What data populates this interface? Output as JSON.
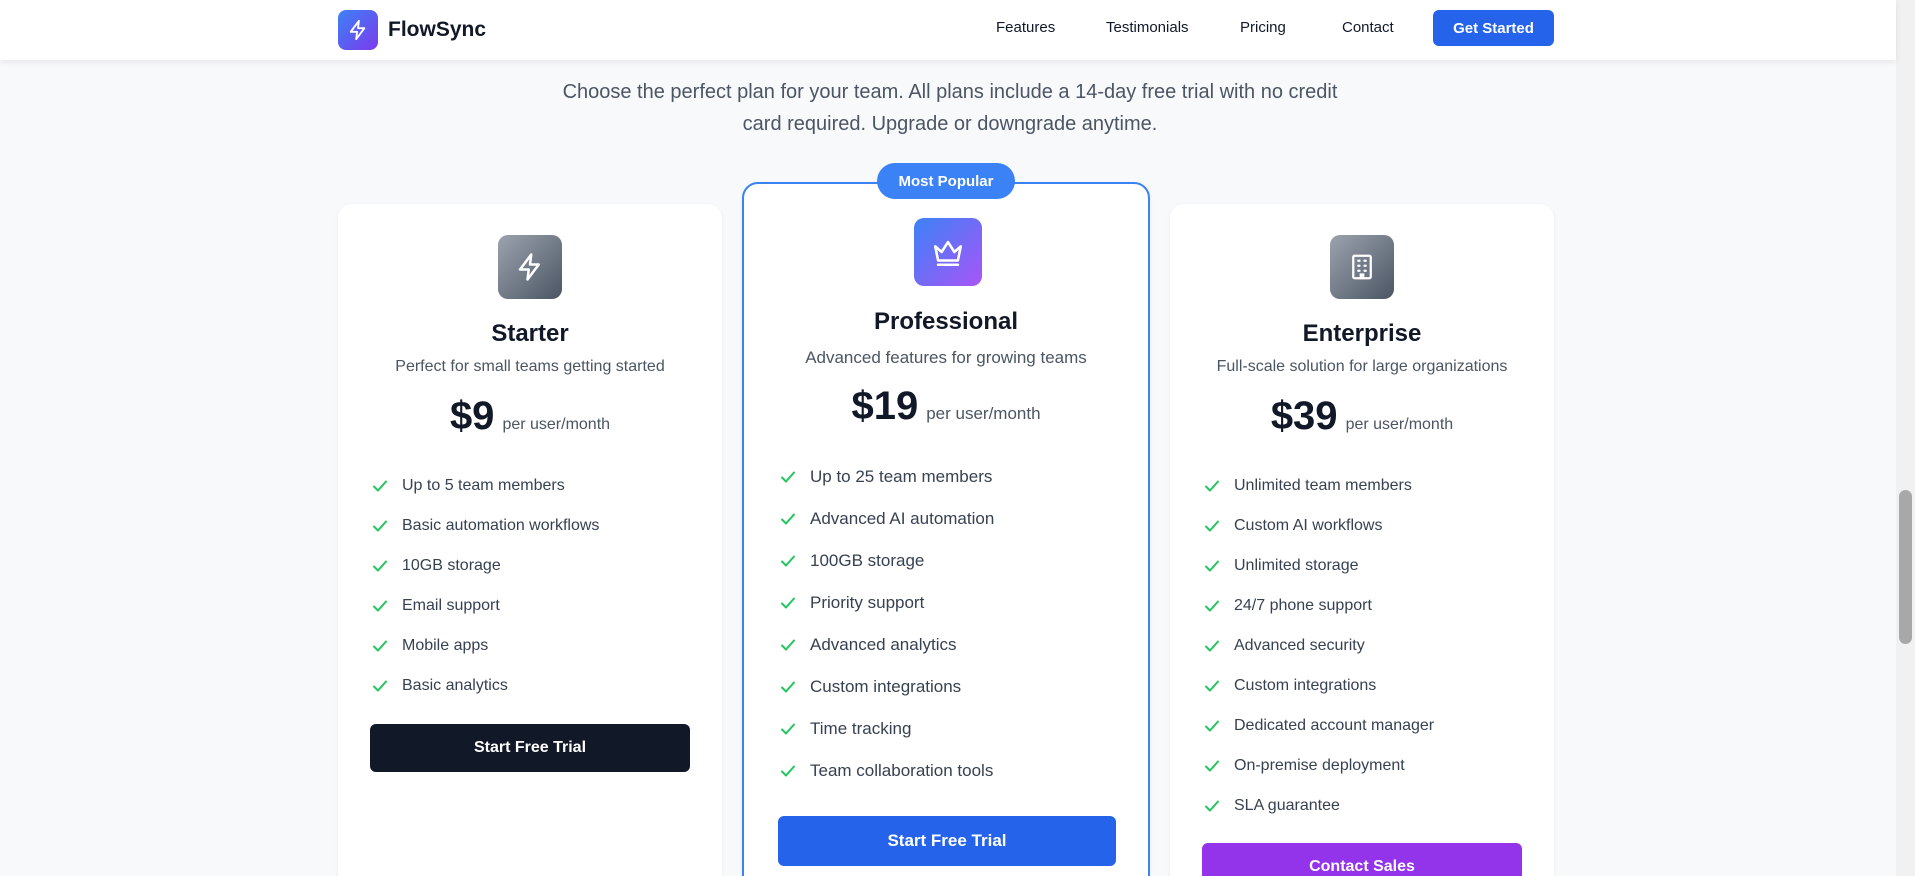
{
  "header": {
    "brand": "FlowSync",
    "nav": [
      "Features",
      "Testimonials",
      "Pricing",
      "Contact"
    ],
    "cta": "Get Started"
  },
  "intro": {
    "text": "Choose the perfect plan for your team. All plans include a 14-day free trial with no credit card required. Upgrade or downgrade anytime."
  },
  "plans": [
    {
      "name": "Starter",
      "description": "Perfect for small teams getting started",
      "price": "$9",
      "period": "per user/month",
      "icon": "lightning-icon",
      "features": [
        "Up to 5 team members",
        "Basic automation workflows",
        "10GB storage",
        "Email support",
        "Mobile apps",
        "Basic analytics"
      ],
      "cta": "Start Free Trial",
      "cta_color": "#111827"
    },
    {
      "name": "Professional",
      "badge": "Most Popular",
      "description": "Advanced features for growing teams",
      "price": "$19",
      "period": "per user/month",
      "icon": "crown-icon",
      "features": [
        "Up to 25 team members",
        "Advanced AI automation",
        "100GB storage",
        "Priority support",
        "Advanced analytics",
        "Custom integrations",
        "Time tracking",
        "Team collaboration tools"
      ],
      "cta": "Start Free Trial",
      "cta_color": "#2563eb"
    },
    {
      "name": "Enterprise",
      "description": "Full-scale solution for large organizations",
      "price": "$39",
      "period": "per user/month",
      "icon": "building-icon",
      "features": [
        "Unlimited team members",
        "Custom AI workflows",
        "Unlimited storage",
        "24/7 phone support",
        "Advanced security",
        "Custom integrations",
        "Dedicated account manager",
        "On-premise deployment",
        "SLA guarantee"
      ],
      "cta": "Contact Sales",
      "cta_color": "#9333ea"
    }
  ],
  "colors": {
    "primary": "#2563eb",
    "accent_purple": "#9333ea",
    "check_green": "#22c55e",
    "dark_button": "#111827",
    "popular_border": "#3b82f6"
  }
}
